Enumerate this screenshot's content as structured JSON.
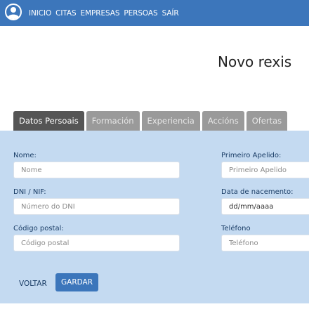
{
  "nav": {
    "items": [
      "INICIO",
      "CITAS",
      "EMPRESAS",
      "PERSOAS",
      "SAÍR"
    ]
  },
  "page": {
    "title": "Novo rexis"
  },
  "tabs": [
    "Datos Persoais",
    "Formación",
    "Experiencia",
    "Accións",
    "Ofertas"
  ],
  "form": {
    "nome": {
      "label": "Nome:",
      "placeholder": "Nome"
    },
    "apelido": {
      "label": "Primeiro Apelido:",
      "placeholder": "Primeiro Apelido"
    },
    "dni": {
      "label": "DNI / NIF:",
      "placeholder": "Número do DNI"
    },
    "nacemento": {
      "label": "Data de nacemento:",
      "value": "dd/mm/aaaa"
    },
    "postal": {
      "label": "Código postal:",
      "placeholder": "Código postal"
    },
    "telefono": {
      "label": "Teléfono",
      "placeholder": "Teléfono"
    }
  },
  "actions": {
    "back": "VOLTAR",
    "save": "GARDAR"
  },
  "colors": {
    "brand": "#3c76bb",
    "panel": "#c4daf1",
    "tab_active": "#555555",
    "tab_inactive": "#9a9a9a"
  }
}
